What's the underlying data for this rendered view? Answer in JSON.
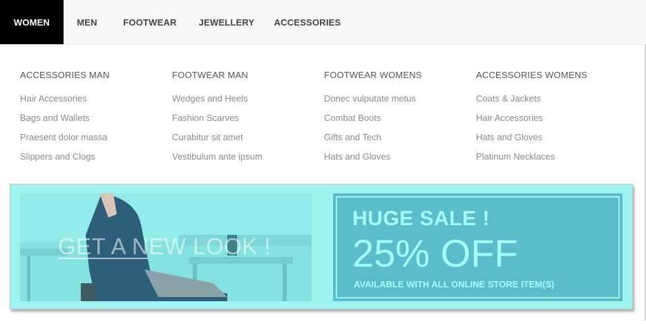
{
  "nav": {
    "items": [
      {
        "label": "WOMEN",
        "active": true
      },
      {
        "label": "MEN"
      },
      {
        "label": "FOOTWEAR"
      },
      {
        "label": "JEWELLERY"
      },
      {
        "label": "ACCESSORIES"
      }
    ]
  },
  "menu": {
    "columns": [
      {
        "title": "ACCESSORIES MAN",
        "links": [
          "Hair Accessories",
          "Bags and Wallets",
          "Praesent dolor massa",
          "Slippers and Clogs"
        ]
      },
      {
        "title": "FOOTWEAR MAN",
        "links": [
          "Wedges and Heels",
          "Fashion Scarves",
          "Curabitur sit amet",
          "Vestibulum ante ipsum"
        ]
      },
      {
        "title": "FOOTWEAR WOMENS",
        "links": [
          "Donec vulputate metus",
          "Combat Boots",
          "Gifts and Tech",
          "Hats and Gloves"
        ]
      },
      {
        "title": "ACCESSORIES WOMENS",
        "links": [
          "Coats & Jackets",
          "Hair Accessories",
          "Hats and Gloves",
          "Platinum Necklaces"
        ]
      }
    ]
  },
  "banner": {
    "photo_caption": "GET A NEW LOOK !",
    "sale_title": "HUGE SALE !",
    "sale_discount": "25% OFF",
    "sale_note": "AVAILABLE WITH ALL ONLINE STORE ITEM(S)",
    "colors": {
      "background": "#9ff3f0",
      "sale_box": "#5bbccb",
      "sale_text": "#a9fbf7"
    }
  }
}
